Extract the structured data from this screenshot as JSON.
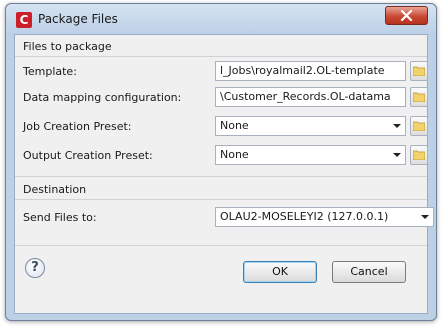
{
  "window": {
    "title": "Package Files",
    "app_icon_letter": "C"
  },
  "files_section": {
    "header": "Files to package",
    "template": {
      "label": "Template:",
      "value": "l_Jobs\\royalmail2.OL-template"
    },
    "data_mapping": {
      "label": "Data mapping configuration:",
      "value": "\\Customer_Records.OL-datama"
    },
    "job_creation": {
      "label": "Job Creation Preset:",
      "selected": "None"
    },
    "output_creation": {
      "label": "Output Creation Preset:",
      "selected": "None"
    }
  },
  "destination_section": {
    "header": "Destination",
    "send_files": {
      "label": "Send Files to:",
      "selected": "OLAU2-MOSELEYI2 (127.0.0.1)"
    }
  },
  "buttons": {
    "ok": "OK",
    "cancel": "Cancel",
    "help_symbol": "?"
  },
  "icons": {
    "close": "close-icon",
    "folder": "folder-icon",
    "help": "help-icon"
  },
  "colors": {
    "frame": "#bcd0e6",
    "close": "#c74a34",
    "folder": "#f2d36b"
  }
}
